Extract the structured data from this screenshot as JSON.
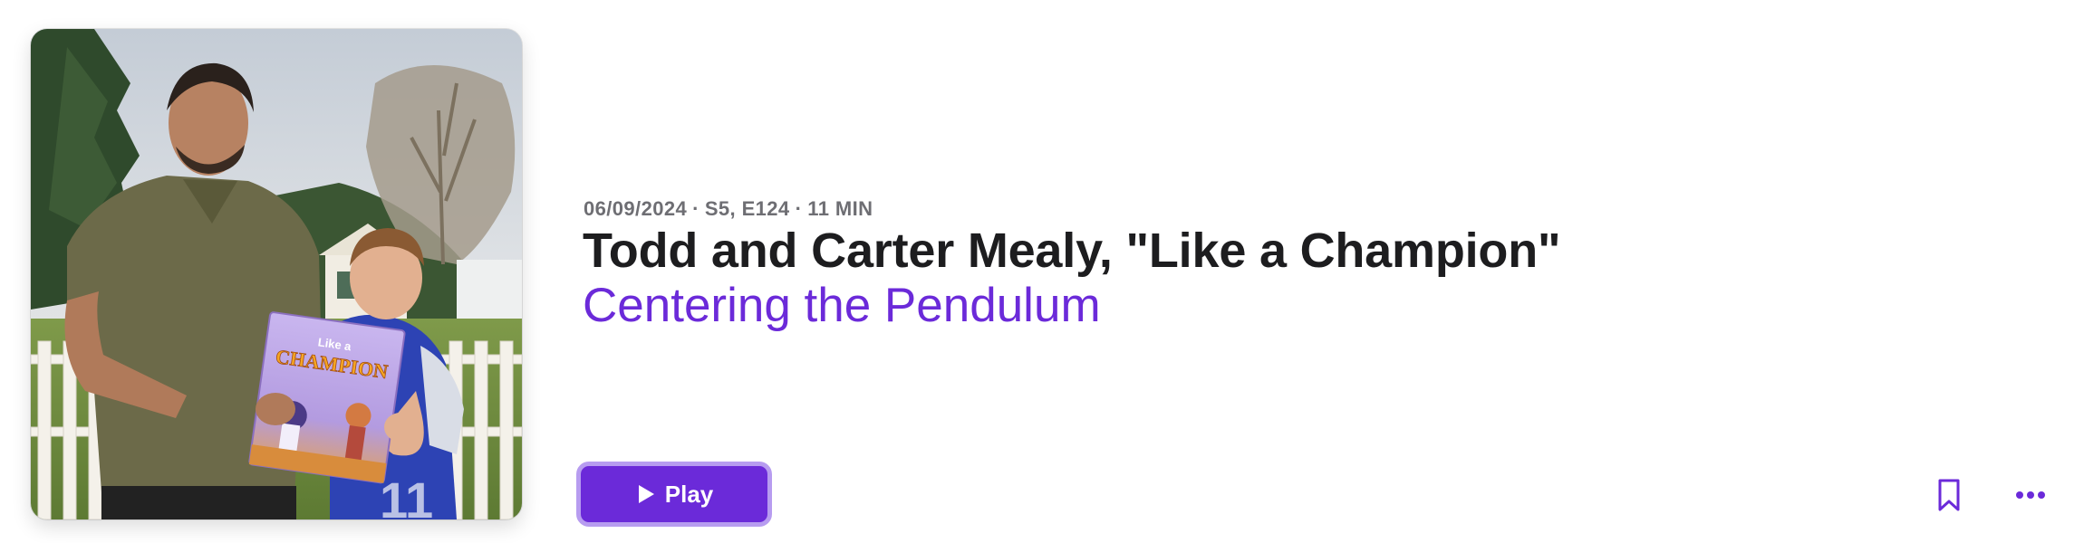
{
  "episode": {
    "date": "06/09/2024",
    "separator": "·",
    "season_episode": "S5, E124",
    "duration": "11 MIN",
    "title": "Todd and Carter Mealy, \"Like a Champion\"",
    "show_name": "Centering the Pendulum"
  },
  "actions": {
    "play_label": "Play",
    "play_icon": "play-triangle-icon",
    "bookmark_icon": "bookmark-icon",
    "more_icon": "ellipsis-icon"
  },
  "artwork": {
    "book_cover_lines": [
      "Like a",
      "CHAMPION"
    ]
  },
  "colors": {
    "accent": "#6b2ad9",
    "accent_border": "#b79cf0",
    "title": "#1d1d1f",
    "meta": "#6e6e73"
  }
}
